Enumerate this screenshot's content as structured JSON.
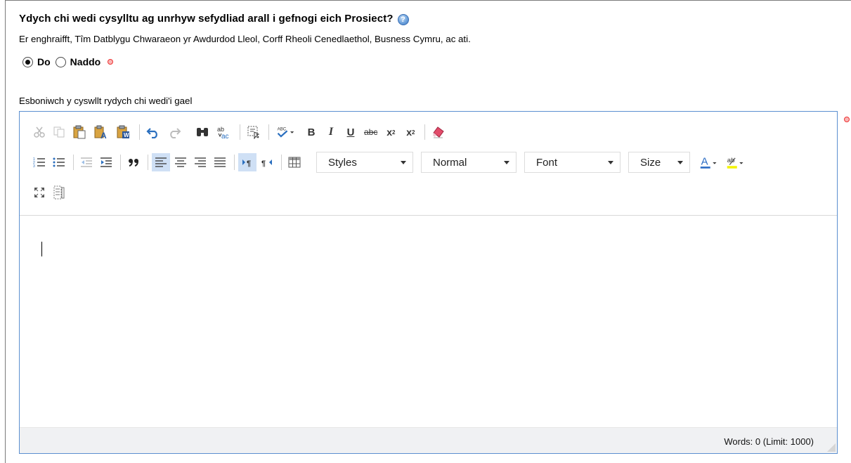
{
  "form": {
    "question": "Ydych chi wedi cysylltu ag unrhyw sefydliad arall i gefnogi eich Prosiect?",
    "hint": "Er enghraifft, Tîm Datblygu Chwaraeon yr Awdurdod Lleol, Corff Rheoli Cenedlaethol, Busness Cymru, ac ati.",
    "radio_yes": "Do",
    "radio_no": "Naddo",
    "selected": "Do",
    "field_label": "Esboniwch y cyswllt rydych chi wedi'i gael"
  },
  "editor": {
    "styles_label": "Styles",
    "format_label": "Normal",
    "font_label": "Font",
    "size_label": "Size",
    "word_count": "Words: 0 (Limit: 1000)",
    "toolbar_icons_row1": [
      "cut-icon",
      "copy-icon",
      "paste-icon",
      "paste-text-icon",
      "paste-word-icon",
      "undo-icon",
      "redo-icon",
      "find-icon",
      "replace-icon",
      "select-all-icon",
      "spellcheck-icon",
      "bold-icon",
      "italic-icon",
      "underline-icon",
      "strikethrough-icon",
      "subscript-icon",
      "superscript-icon",
      "remove-format-icon"
    ],
    "toolbar_icons_row2": [
      "numbered-list-icon",
      "bulleted-list-icon",
      "outdent-icon",
      "indent-icon",
      "blockquote-icon",
      "align-left-icon",
      "align-center-icon",
      "align-right-icon",
      "justify-icon",
      "ltr-icon",
      "rtl-icon",
      "table-icon",
      "text-color-icon",
      "background-color-icon"
    ],
    "toolbar_icons_row3": [
      "maximize-icon",
      "show-blocks-icon"
    ],
    "colors": {
      "accent_border": "#5b8fd0",
      "active_button": "#cfe0f5",
      "required_dot": "#e33333",
      "text_color_bar": "#2b6cc4",
      "highlight_bar": "#f3f300"
    }
  }
}
